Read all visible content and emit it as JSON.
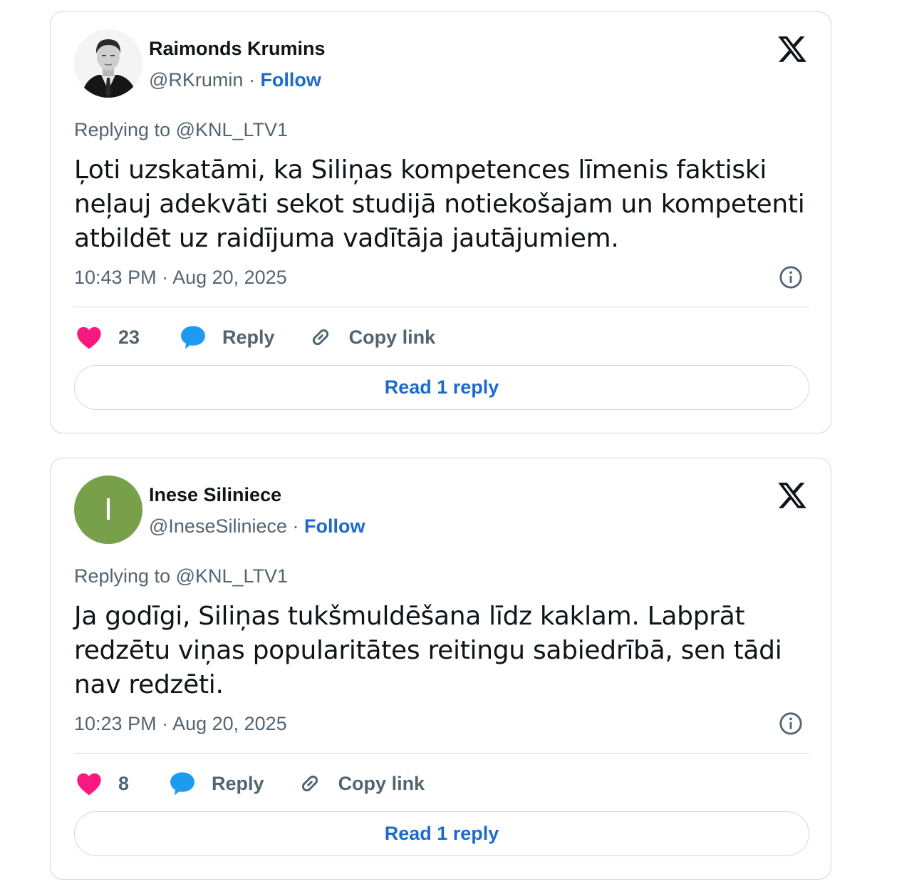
{
  "tweets": [
    {
      "author_name": "Raimonds Krumins",
      "handle": "@RKrumin",
      "separator": " · ",
      "follow_label": "Follow",
      "avatar": "photo",
      "replying_to": "Replying to @KNL_LTV1",
      "text": "Ļoti uzskatāmi, ka Siliņas kompetences līmenis faktiski neļauj adekvāti sekot studijā notiekošajam un kompetenti atbildēt uz raidījuma vadītāja jautājumiem.",
      "timestamp": "10:43 PM · Aug 20, 2025",
      "likes": "23",
      "reply_label": "Reply",
      "copy_link_label": "Copy link",
      "read_replies_label": "Read 1 reply"
    },
    {
      "author_name": "Inese Siliniece",
      "handle": "@IneseSiliniece",
      "separator": " · ",
      "follow_label": "Follow",
      "avatar_letter": "I",
      "avatar_color": "#78a04b",
      "replying_to": "Replying to @KNL_LTV1",
      "text": "Ja godīgi, Siliņas tukšmuldēšana līdz kaklam. Labprāt redzētu viņas popularitātes reitingu sabiedrībā, sen tādi nav redzēti.",
      "timestamp": "10:23 PM · Aug 20, 2025",
      "likes": "8",
      "reply_label": "Reply",
      "copy_link_label": "Copy link",
      "read_replies_label": "Read 1 reply"
    }
  ],
  "colors": {
    "link_blue": "#1d6bc9",
    "like_pink": "#f91880",
    "reply_blue": "#1d9bf0",
    "muted_text": "#536471",
    "border": "#cfd9de"
  },
  "icons": [
    "x-logo-icon",
    "heart-icon",
    "reply-bubble-icon",
    "link-icon",
    "info-icon"
  ]
}
